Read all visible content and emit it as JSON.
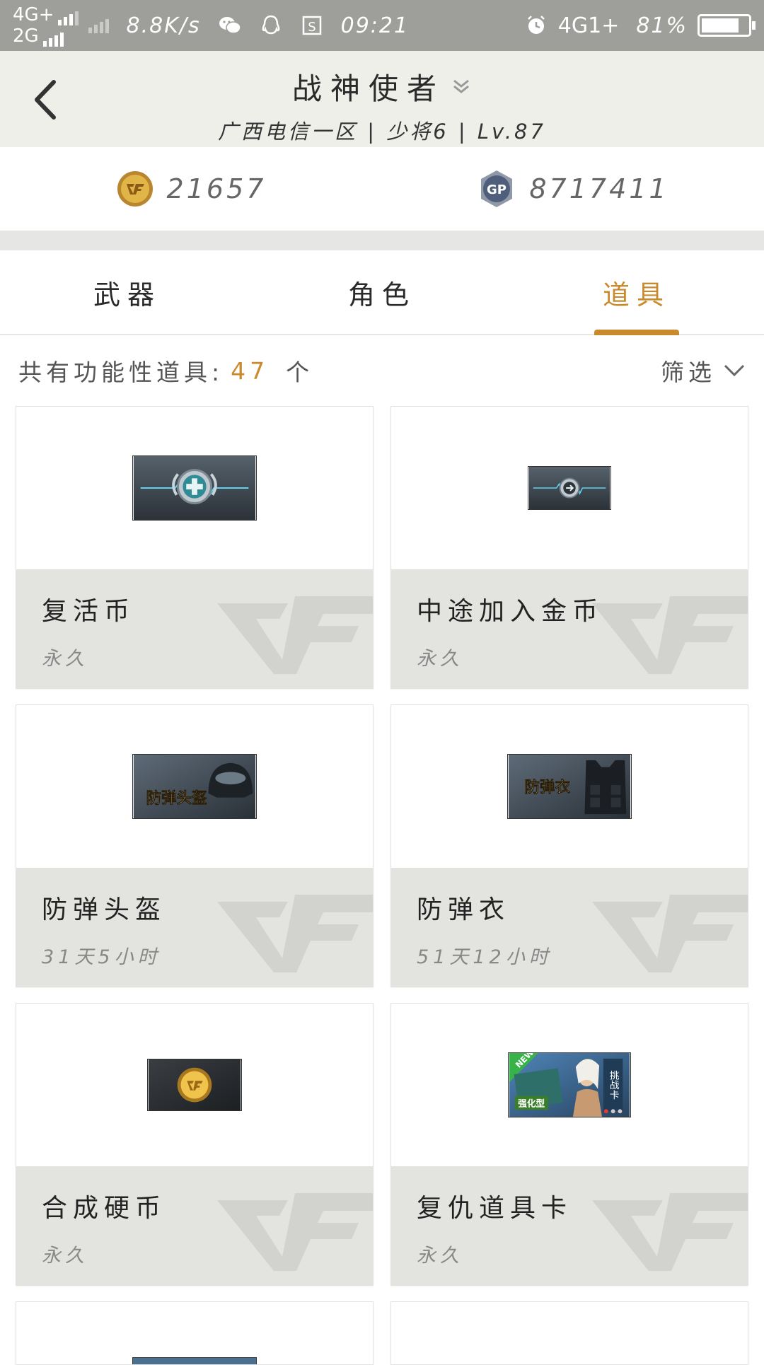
{
  "statusbar": {
    "net_top": "4G+",
    "net_bottom": "2G",
    "speed": "8.8K/s",
    "time": "09:21",
    "net_right": "4G1+",
    "battery": "81%",
    "battery_level": 0.81,
    "icons": [
      "signal-icon",
      "wechat-icon",
      "qq-icon",
      "s-icon",
      "alarm-icon",
      "battery-icon"
    ]
  },
  "header": {
    "title": "战神使者",
    "subtitle": "广西电信一区 | 少将6 | Lv.87"
  },
  "currency": {
    "cf_value": "21657",
    "gp_label": "GP",
    "gp_value": "8717411"
  },
  "tabs": [
    {
      "label": "武器",
      "active": false
    },
    {
      "label": "角色",
      "active": false
    },
    {
      "label": "道具",
      "active": true
    }
  ],
  "count": {
    "prefix": "共有功能性道具:",
    "value": "47",
    "suffix": "个",
    "filter_label": "筛选"
  },
  "items": [
    {
      "name": "复活币",
      "duration": "永久",
      "thumb_text": ""
    },
    {
      "name": "中途加入金币",
      "duration": "永久",
      "thumb_text": ""
    },
    {
      "name": "防弹头盔",
      "duration": "31天5小时",
      "thumb_text": "防弹头盔"
    },
    {
      "name": "防弹衣",
      "duration": "51天12小时",
      "thumb_text": "防弹衣"
    },
    {
      "name": "合成硬币",
      "duration": "永久",
      "thumb_text": ""
    },
    {
      "name": "复仇道具卡",
      "duration": "永久",
      "thumb_text": "挑战卡"
    }
  ],
  "thumb_badges": {
    "new": "NEW",
    "enhanced": "强化型"
  },
  "colors": {
    "accent": "#c98a2e",
    "statusbar": "#9e9e9b",
    "header": "#efefea",
    "card_info": "#e3e3e0"
  }
}
